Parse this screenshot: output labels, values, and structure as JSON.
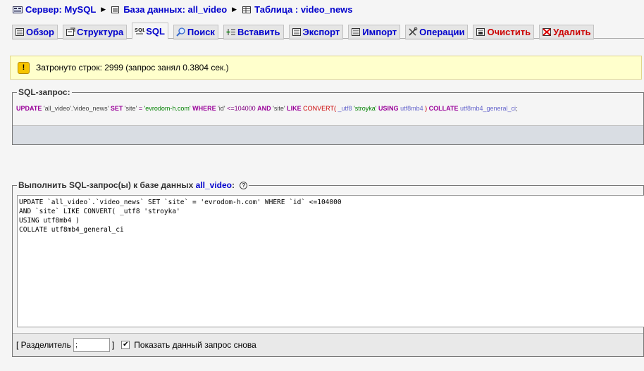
{
  "breadcrumb": {
    "server": "Сервер: MySQL",
    "database": "База данных: all_video",
    "table": "Таблица : video_news"
  },
  "tabs": [
    {
      "label": "Обзор",
      "icon": "browse-icon"
    },
    {
      "label": "Структура",
      "icon": "structure-icon"
    },
    {
      "label": "SQL",
      "icon": "sql-icon"
    },
    {
      "label": "Поиск",
      "icon": "search-icon"
    },
    {
      "label": "Вставить",
      "icon": "insert-icon"
    },
    {
      "label": "Экспорт",
      "icon": "export-icon"
    },
    {
      "label": "Импорт",
      "icon": "import-icon"
    },
    {
      "label": "Операции",
      "icon": "operations-icon"
    },
    {
      "label": "Очистить",
      "icon": "empty-icon"
    },
    {
      "label": "Удалить",
      "icon": "drop-icon"
    }
  ],
  "active_tab": "SQL",
  "notice": {
    "text": "Затронуто строк: 2999 (запрос занял 0.3804 сек.)"
  },
  "sql_query": {
    "legend": "SQL-запрос:",
    "tokens": {
      "t1": "UPDATE",
      "t2": "'all_video'.'video_news'",
      "t3": "SET",
      "t4": "'site'",
      "t5": "=",
      "t6": "'evrodom-h.com'",
      "t7": "WHERE",
      "t8": "'id'",
      "t9": "<=",
      "t10": "104000",
      "t11": "AND",
      "t12": "'site'",
      "t13": "LIKE",
      "t14": "CONVERT(",
      "t15": "_utf8",
      "t16": "'stroyka'",
      "t17": "USING",
      "t18": "utf8mb4",
      "t19": ")",
      "t20": "COLLATE",
      "t21": "utf8mb4_general_ci",
      "t22": ";"
    }
  },
  "run_sql": {
    "legend_prefix": "Выполнить SQL-запрос(ы) к базе данных",
    "database": "all_video",
    "legend_suffix": ":",
    "query_text": "UPDATE `all_video`.`video_news` SET `site` = 'evrodom-h.com' WHERE `id` <=104000\nAND `site` LIKE CONVERT( _utf8 'stroyka'\nUSING utf8mb4 )\nCOLLATE utf8mb4_general_ci",
    "delimiter_open": "[ Разделитель",
    "delimiter_value": ";",
    "delimiter_close": "]",
    "show_query_label": "Показать данный запрос снова",
    "show_query_checked": true
  },
  "colors": {
    "link": "#0000cc",
    "danger": "#cc0000",
    "notice_bg": "#ffffcc"
  }
}
